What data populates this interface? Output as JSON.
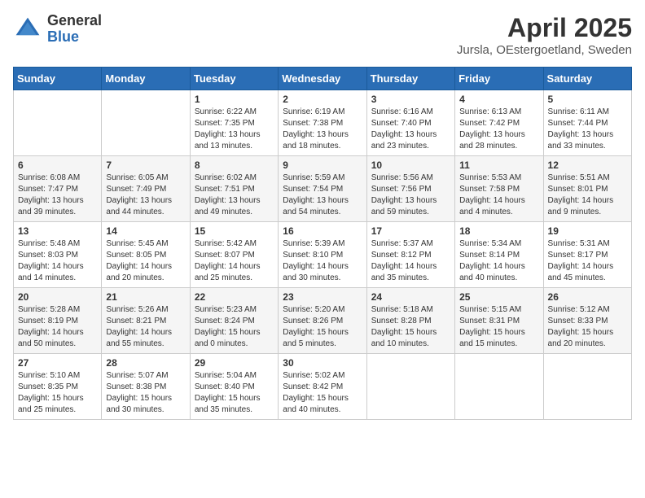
{
  "logo": {
    "general": "General",
    "blue": "Blue"
  },
  "title": "April 2025",
  "location": "Jursla, OEstergoetland, Sweden",
  "days_header": [
    "Sunday",
    "Monday",
    "Tuesday",
    "Wednesday",
    "Thursday",
    "Friday",
    "Saturday"
  ],
  "weeks": [
    [
      {
        "day": "",
        "info": ""
      },
      {
        "day": "",
        "info": ""
      },
      {
        "day": "1",
        "info": "Sunrise: 6:22 AM\nSunset: 7:35 PM\nDaylight: 13 hours and 13 minutes."
      },
      {
        "day": "2",
        "info": "Sunrise: 6:19 AM\nSunset: 7:38 PM\nDaylight: 13 hours and 18 minutes."
      },
      {
        "day": "3",
        "info": "Sunrise: 6:16 AM\nSunset: 7:40 PM\nDaylight: 13 hours and 23 minutes."
      },
      {
        "day": "4",
        "info": "Sunrise: 6:13 AM\nSunset: 7:42 PM\nDaylight: 13 hours and 28 minutes."
      },
      {
        "day": "5",
        "info": "Sunrise: 6:11 AM\nSunset: 7:44 PM\nDaylight: 13 hours and 33 minutes."
      }
    ],
    [
      {
        "day": "6",
        "info": "Sunrise: 6:08 AM\nSunset: 7:47 PM\nDaylight: 13 hours and 39 minutes."
      },
      {
        "day": "7",
        "info": "Sunrise: 6:05 AM\nSunset: 7:49 PM\nDaylight: 13 hours and 44 minutes."
      },
      {
        "day": "8",
        "info": "Sunrise: 6:02 AM\nSunset: 7:51 PM\nDaylight: 13 hours and 49 minutes."
      },
      {
        "day": "9",
        "info": "Sunrise: 5:59 AM\nSunset: 7:54 PM\nDaylight: 13 hours and 54 minutes."
      },
      {
        "day": "10",
        "info": "Sunrise: 5:56 AM\nSunset: 7:56 PM\nDaylight: 13 hours and 59 minutes."
      },
      {
        "day": "11",
        "info": "Sunrise: 5:53 AM\nSunset: 7:58 PM\nDaylight: 14 hours and 4 minutes."
      },
      {
        "day": "12",
        "info": "Sunrise: 5:51 AM\nSunset: 8:01 PM\nDaylight: 14 hours and 9 minutes."
      }
    ],
    [
      {
        "day": "13",
        "info": "Sunrise: 5:48 AM\nSunset: 8:03 PM\nDaylight: 14 hours and 14 minutes."
      },
      {
        "day": "14",
        "info": "Sunrise: 5:45 AM\nSunset: 8:05 PM\nDaylight: 14 hours and 20 minutes."
      },
      {
        "day": "15",
        "info": "Sunrise: 5:42 AM\nSunset: 8:07 PM\nDaylight: 14 hours and 25 minutes."
      },
      {
        "day": "16",
        "info": "Sunrise: 5:39 AM\nSunset: 8:10 PM\nDaylight: 14 hours and 30 minutes."
      },
      {
        "day": "17",
        "info": "Sunrise: 5:37 AM\nSunset: 8:12 PM\nDaylight: 14 hours and 35 minutes."
      },
      {
        "day": "18",
        "info": "Sunrise: 5:34 AM\nSunset: 8:14 PM\nDaylight: 14 hours and 40 minutes."
      },
      {
        "day": "19",
        "info": "Sunrise: 5:31 AM\nSunset: 8:17 PM\nDaylight: 14 hours and 45 minutes."
      }
    ],
    [
      {
        "day": "20",
        "info": "Sunrise: 5:28 AM\nSunset: 8:19 PM\nDaylight: 14 hours and 50 minutes."
      },
      {
        "day": "21",
        "info": "Sunrise: 5:26 AM\nSunset: 8:21 PM\nDaylight: 14 hours and 55 minutes."
      },
      {
        "day": "22",
        "info": "Sunrise: 5:23 AM\nSunset: 8:24 PM\nDaylight: 15 hours and 0 minutes."
      },
      {
        "day": "23",
        "info": "Sunrise: 5:20 AM\nSunset: 8:26 PM\nDaylight: 15 hours and 5 minutes."
      },
      {
        "day": "24",
        "info": "Sunrise: 5:18 AM\nSunset: 8:28 PM\nDaylight: 15 hours and 10 minutes."
      },
      {
        "day": "25",
        "info": "Sunrise: 5:15 AM\nSunset: 8:31 PM\nDaylight: 15 hours and 15 minutes."
      },
      {
        "day": "26",
        "info": "Sunrise: 5:12 AM\nSunset: 8:33 PM\nDaylight: 15 hours and 20 minutes."
      }
    ],
    [
      {
        "day": "27",
        "info": "Sunrise: 5:10 AM\nSunset: 8:35 PM\nDaylight: 15 hours and 25 minutes."
      },
      {
        "day": "28",
        "info": "Sunrise: 5:07 AM\nSunset: 8:38 PM\nDaylight: 15 hours and 30 minutes."
      },
      {
        "day": "29",
        "info": "Sunrise: 5:04 AM\nSunset: 8:40 PM\nDaylight: 15 hours and 35 minutes."
      },
      {
        "day": "30",
        "info": "Sunrise: 5:02 AM\nSunset: 8:42 PM\nDaylight: 15 hours and 40 minutes."
      },
      {
        "day": "",
        "info": ""
      },
      {
        "day": "",
        "info": ""
      },
      {
        "day": "",
        "info": ""
      }
    ]
  ]
}
